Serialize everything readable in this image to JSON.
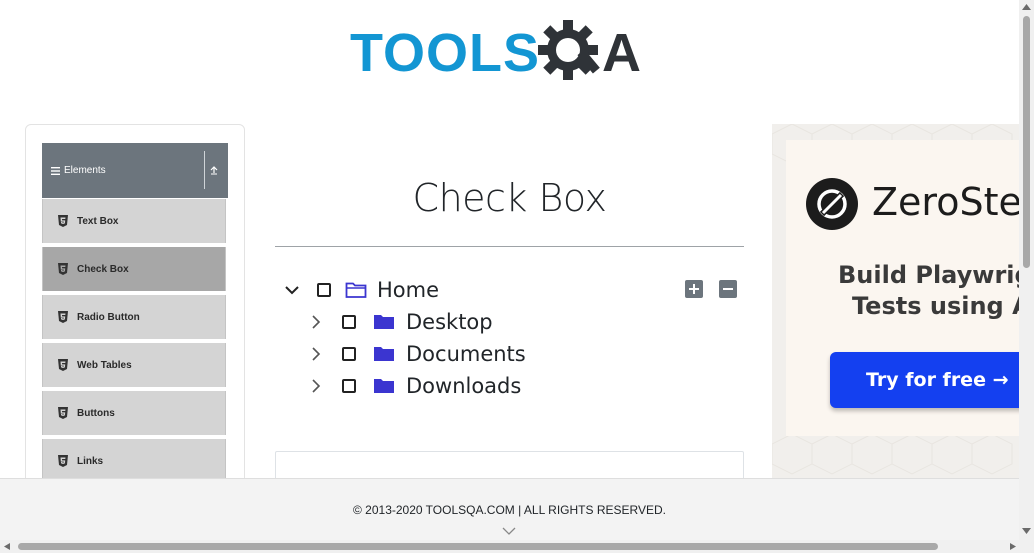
{
  "header": {
    "logo_part1": "TOOLS",
    "logo_part2": "A",
    "brand_blue": "#1396d3",
    "brand_dark": "#2f3338"
  },
  "sidebar": {
    "group_title": "Elements",
    "group_icon": "menu-icon",
    "collapse_icon": "collapse-up-icon",
    "items": [
      {
        "label": "Text Box",
        "icon": "html5-icon",
        "active": false
      },
      {
        "label": "Check Box",
        "icon": "html5-icon",
        "active": true
      },
      {
        "label": "Radio Button",
        "icon": "html5-icon",
        "active": false
      },
      {
        "label": "Web Tables",
        "icon": "html5-icon",
        "active": false
      },
      {
        "label": "Buttons",
        "icon": "html5-icon",
        "active": false
      },
      {
        "label": "Links",
        "icon": "html5-icon",
        "active": false
      }
    ]
  },
  "main": {
    "title": "Check Box",
    "tree": {
      "root": {
        "label": "Home",
        "expanded": true,
        "checked": false,
        "icon": "folder-open-icon"
      },
      "children": [
        {
          "label": "Desktop",
          "expanded": false,
          "checked": false,
          "icon": "folder-closed-icon"
        },
        {
          "label": "Documents",
          "expanded": false,
          "checked": false,
          "icon": "folder-closed-icon"
        },
        {
          "label": "Downloads",
          "expanded": false,
          "checked": false,
          "icon": "folder-closed-icon"
        }
      ],
      "expand_all_icon": "plus-icon",
      "collapse_all_icon": "minus-icon"
    }
  },
  "ad": {
    "brand": "ZeroSte",
    "headline_line1": "Build Playwrigh",
    "headline_line2": "Tests using A",
    "cta_label": "Try for free →",
    "cta_color": "#1440f0"
  },
  "footer": {
    "copyright": "© 2013-2020 TOOLSQA.COM | ALL RIGHTS RESERVED."
  }
}
